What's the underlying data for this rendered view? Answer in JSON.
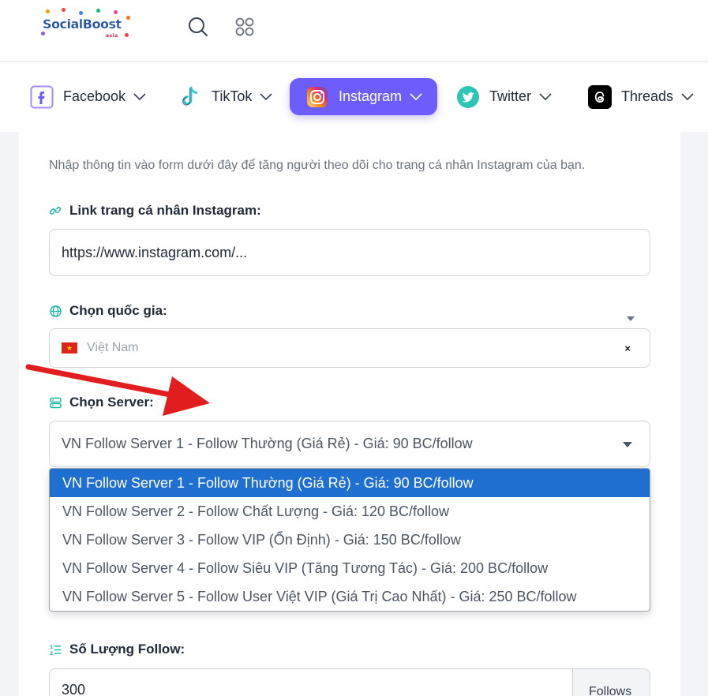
{
  "header": {
    "logo_text": "SocialBoost",
    "logo_sub": "asia",
    "search_icon": "search-icon",
    "apps_icon": "apps-grid-icon"
  },
  "nav": {
    "items": [
      {
        "label": "Facebook",
        "icon": "facebook-icon",
        "active": false
      },
      {
        "label": "TikTok",
        "icon": "tiktok-icon",
        "active": false
      },
      {
        "label": "Instagram",
        "icon": "instagram-icon",
        "active": true
      },
      {
        "label": "Twitter",
        "icon": "twitter-icon",
        "active": false
      },
      {
        "label": "Threads",
        "icon": "threads-icon",
        "active": false
      }
    ],
    "active_color": "#6d5dfc"
  },
  "form": {
    "intro": "Nhập thông tin vào form dưới đây để tăng người theo dõi cho trang cá nhân Instagram của bạn.",
    "link_label": "Link trang cá nhân Instagram:",
    "link_value": "https://www.instagram.com/...",
    "country_label": "Chọn quốc gia:",
    "country_value": "Việt Nam",
    "clear": "×",
    "server_label": "Chọn Server:",
    "server_value": "VN Follow Server 1 - Follow Thường (Giá Rẻ) - Giá: 90 BC/follow",
    "server_options": [
      "VN Follow Server 1 - Follow Thường (Giá Rẻ) - Giá: 90 BC/follow",
      "VN Follow Server 2 - Follow Chất Lượng - Giá: 120 BC/follow",
      "VN Follow Server 3 - Follow VIP (Ổn Định) - Giá: 150 BC/follow",
      "VN Follow Server 4 - Follow Siêu VIP (Tăng Tương Tác) - Giá: 200 BC/follow",
      "VN Follow Server 5 - Follow User Việt VIP (Giá Trị Cao Nhất) - Giá: 250 BC/follow"
    ],
    "selected_color": "#1f6fd1",
    "qty_label": "Số Lượng Follow:",
    "qty_value": "300",
    "qty_unit": "Follows"
  },
  "annotation": {
    "arrow_color": "#e11d1d"
  }
}
